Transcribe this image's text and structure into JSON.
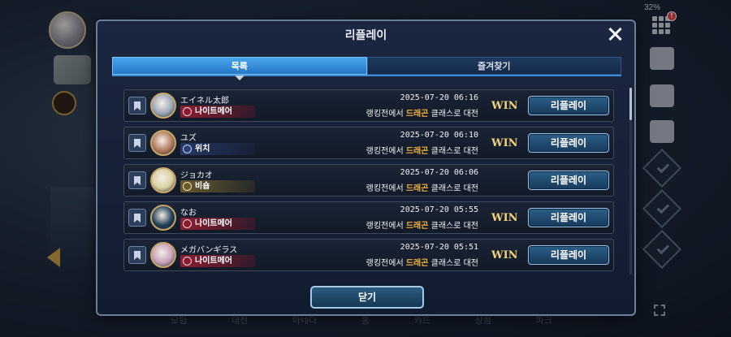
{
  "status_bar": {
    "battery": "32%",
    "notification_count": "!"
  },
  "dialog": {
    "title": "리플레이",
    "tabs": [
      {
        "label": "목록",
        "active": true
      },
      {
        "label": "즐겨찾기",
        "active": false
      }
    ],
    "close_button_label": "닫기"
  },
  "replays": [
    {
      "player": "エイネル太郎",
      "class": "나이트메어",
      "class_key": "nightmare",
      "datetime": "2025-07-20 06:16",
      "desc_pre": "랭킹전에서 ",
      "desc_class": "드래곤",
      "desc_post": " 클래스로 대전",
      "result": "WIN",
      "button": "리플레이",
      "avatar_color": "#9aa6b8"
    },
    {
      "player": "ユズ",
      "class": "위치",
      "class_key": "witch",
      "datetime": "2025-07-20 06:10",
      "desc_pre": "랭킹전에서 ",
      "desc_class": "드래곤",
      "desc_post": " 클래스로 대전",
      "result": "WIN",
      "button": "리플레이",
      "avatar_color": "#b07a5a"
    },
    {
      "player": "ジョカオ",
      "class": "비숍",
      "class_key": "bishop",
      "datetime": "2025-07-20 06:06",
      "desc_pre": "랭킹전에서 ",
      "desc_class": "드래곤",
      "desc_post": " 클래스로 대전",
      "result": "",
      "button": "리플레이",
      "avatar_color": "#d9d0a0"
    },
    {
      "player": "なお",
      "class": "나이트메어",
      "class_key": "nightmare",
      "datetime": "2025-07-20 05:55",
      "desc_pre": "랭킹전에서 ",
      "desc_class": "드래곤",
      "desc_post": " 클래스로 대전",
      "result": "WIN",
      "button": "리플레이",
      "avatar_color": "#1f3e56"
    },
    {
      "player": "メガバンギラス",
      "class": "나이트메어",
      "class_key": "nightmare",
      "datetime": "2025-07-20 05:51",
      "desc_pre": "랭킹전에서 ",
      "desc_class": "드래곤",
      "desc_post": " 클래스로 대전",
      "result": "WIN",
      "button": "리플레이",
      "avatar_color": "#c7a0b8"
    }
  ],
  "bottom_nav": [
    "모험",
    "대전",
    "마네다",
    "홈",
    "카드",
    "상점",
    "파크"
  ],
  "colors": {
    "accent": "#3a8ed8",
    "highlight": "#f1b23a",
    "win": "#f2d27a"
  }
}
